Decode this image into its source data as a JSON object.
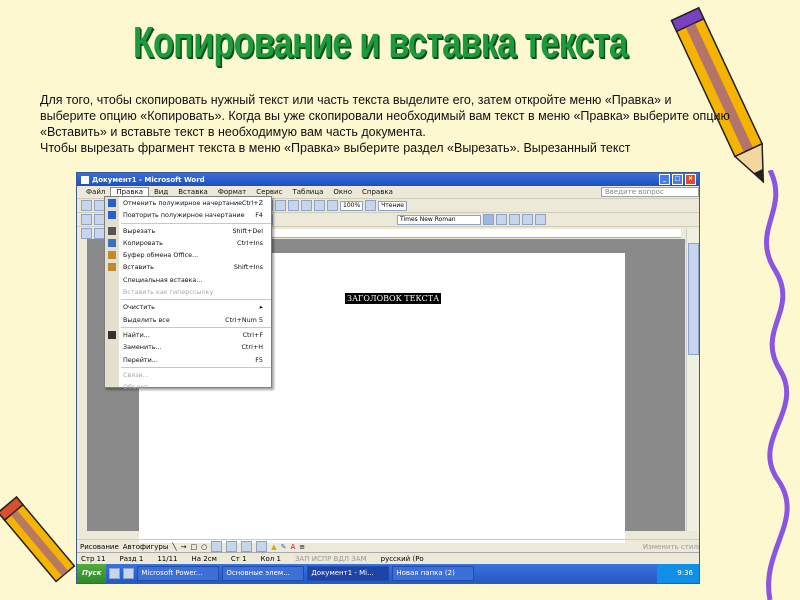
{
  "slide": {
    "title": "Копирование и вставка текста",
    "paragraph1": "Для того, чтобы скопировать нужный текст или часть текста выделите его, затем откройте меню «Правка» и выберите опцию «Копировать». Когда вы уже скопировали необходимый вам текст в меню «Правка» выберите опцию «Вставить» и вставьте текст в необходимую вам часть документа.",
    "paragraph2": "Чтобы вырезать фрагмент текста в меню «Правка» выберите раздел «Вырезать». Вырезанный текст"
  },
  "window": {
    "title": "Документ1 - Microsoft Word",
    "menu": [
      "Файл",
      "Правка",
      "Вид",
      "Вставка",
      "Формат",
      "Сервис",
      "Таблица",
      "Окно",
      "Справка"
    ],
    "help_placeholder": "Введите вопрос",
    "zoom": "100%",
    "reading_mode": "Чтение",
    "font": "Times New Roman",
    "doc_heading": "ЗАГОЛОВОК ТЕКСТА",
    "draw_toolbar": {
      "draw": "Рисование",
      "autoshapes": "Автофигуры",
      "change_shape": "Изменить стиль"
    },
    "status": {
      "page": "Стр 11",
      "section": "Разд 1",
      "pages": "11/11",
      "at": "На 2см",
      "line": "Ст 1",
      "col": "Кол 1",
      "modes": "ЗАП  ИСПР  ВДЛ  ЗАМ",
      "lang": "русский (Ро"
    },
    "taskbar": {
      "start": "Пуск",
      "tasks": [
        "Microsoft Power...",
        "Основные элем...",
        "Документ1 - Mi...",
        "Новая папка (2)"
      ],
      "active_index": 2,
      "clock": "9:36"
    }
  },
  "edit_menu": {
    "items": [
      {
        "label": "Отменить полужирное начертание",
        "shortcut": "Ctrl+Z",
        "icon": "undo-icon",
        "enabled": true
      },
      {
        "label": "Повторить полужирное начертание",
        "shortcut": "F4",
        "icon": "redo-icon",
        "enabled": true
      },
      {
        "sep": true
      },
      {
        "label": "Вырезать",
        "shortcut": "Shift+Del",
        "icon": "scissors-icon",
        "enabled": true
      },
      {
        "label": "Копировать",
        "shortcut": "Ctrl+Ins",
        "icon": "copy-icon",
        "enabled": true
      },
      {
        "label": "Буфер обмена Office...",
        "shortcut": "",
        "icon": "clipboard-icon",
        "enabled": true
      },
      {
        "label": "Вставить",
        "shortcut": "Shift+Ins",
        "icon": "paste-icon",
        "enabled": true
      },
      {
        "label": "Специальная вставка...",
        "shortcut": "",
        "icon": "",
        "enabled": true
      },
      {
        "label": "Вставить как гиперссылку",
        "shortcut": "",
        "icon": "",
        "enabled": false
      },
      {
        "sep": true
      },
      {
        "label": "Очистить",
        "shortcut": "▸",
        "icon": "",
        "enabled": true
      },
      {
        "label": "Выделить все",
        "shortcut": "Ctrl+Num 5",
        "icon": "",
        "enabled": true
      },
      {
        "sep": true
      },
      {
        "label": "Найти...",
        "shortcut": "Ctrl+F",
        "icon": "binoculars-icon",
        "enabled": true
      },
      {
        "label": "Заменить...",
        "shortcut": "Ctrl+H",
        "icon": "",
        "enabled": true
      },
      {
        "label": "Перейти...",
        "shortcut": "F5",
        "icon": "",
        "enabled": true
      },
      {
        "sep": true
      },
      {
        "label": "Связи...",
        "shortcut": "",
        "icon": "",
        "enabled": false
      },
      {
        "label": "Объект",
        "shortcut": "",
        "icon": "",
        "enabled": false
      }
    ]
  },
  "colors": {
    "slide_bg": "#fdf8cf",
    "title": "#1d9a3b",
    "titlebar": "#2a5fcf",
    "pencil_body": "#f5b400",
    "pencil_stripe": "#7a3fc2",
    "squiggle": "#8a55e0"
  }
}
